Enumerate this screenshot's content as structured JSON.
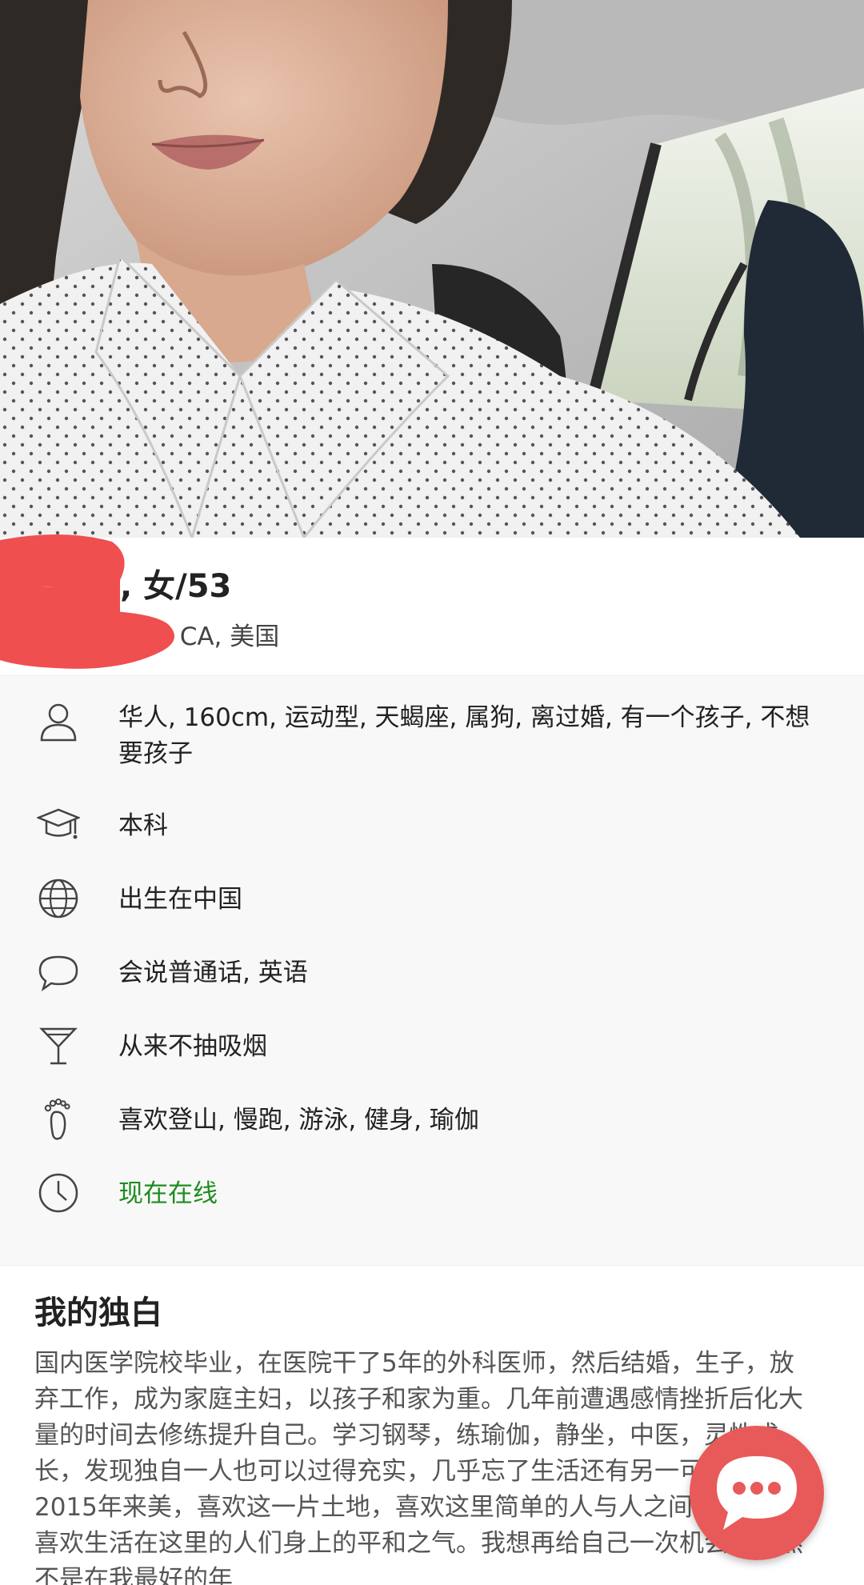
{
  "profile": {
    "name_suffix": ", 女/53",
    "location_suffix": ", CA, 美国"
  },
  "details": [
    {
      "icon": "person-icon",
      "text": "华人, 160cm, 运动型, 天蝎座, 属狗, 离过婚, 有一个孩子, 不想要孩子"
    },
    {
      "icon": "graduation-cap-icon",
      "text": "本科"
    },
    {
      "icon": "globe-icon",
      "text": "出生在中国"
    },
    {
      "icon": "speech-bubble-icon",
      "text": "会说普通话, 英语"
    },
    {
      "icon": "cocktail-glass-icon",
      "text": "从来不抽吸烟"
    },
    {
      "icon": "footprint-icon",
      "text": "喜欢登山, 慢跑, 游泳, 健身, 瑜伽"
    },
    {
      "icon": "clock-icon",
      "text": "现在在线"
    }
  ],
  "monologue": {
    "title": "我的独白",
    "body": "国内医学院校毕业，在医院干了5年的外科医师，然后结婚，生子，放弃工作，成为家庭主妇，以孩子和家为重。几年前遭遇感情挫折后化大量的时间去修练提升自己。学习钢琴，练瑜伽，静坐，中医，灵性成长，发现独自一人也可以过得充实，几乎忘了生活还有另一可能，直至2015年来美，喜欢这一片土地，喜欢这里简单的人与人之间相处之道，喜欢生活在这里的人们身上的平和之气。我想再给自己一次机会，虽然不是在我最好的年"
  },
  "colors": {
    "online": "#1e8c1e",
    "chat_fab": "#e85a5a",
    "redaction": "#ef4f4f"
  },
  "chat_button": {
    "icon": "chat-bubble-icon"
  }
}
